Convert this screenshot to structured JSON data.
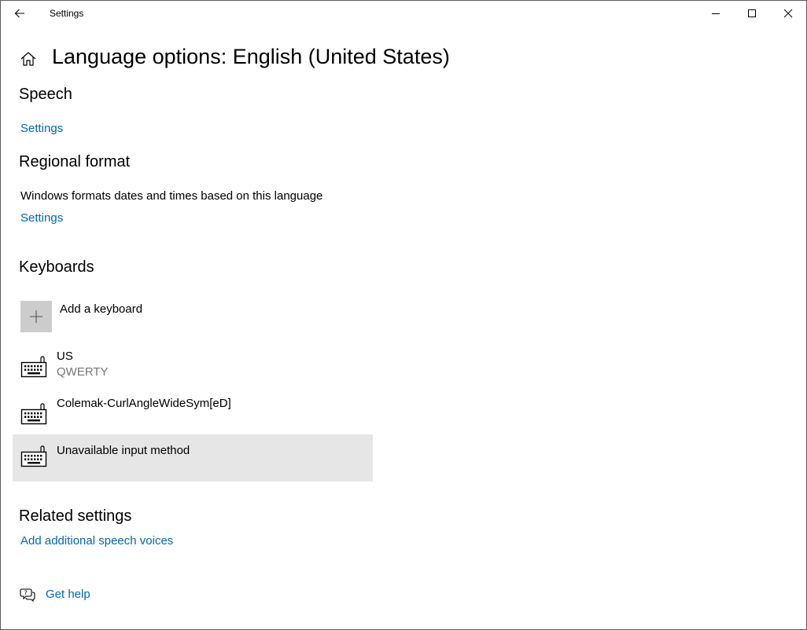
{
  "titlebar": {
    "title": "Settings",
    "back_icon": "back-arrow-icon",
    "minimize_icon": "minimize-icon",
    "maximize_icon": "maximize-icon",
    "close_icon": "close-icon"
  },
  "header": {
    "home_icon": "home-icon",
    "title": "Language options: English (United States)"
  },
  "speech": {
    "heading": "Speech",
    "settings_link": "Settings"
  },
  "regional_format": {
    "heading": "Regional format",
    "description": "Windows formats dates and times based on this language",
    "settings_link": "Settings"
  },
  "keyboards": {
    "heading": "Keyboards",
    "add_label": "Add a keyboard",
    "items": [
      {
        "name": "US",
        "sub": "QWERTY",
        "selected": false
      },
      {
        "name": "Colemak-CurlAngleWideSym[eD]",
        "sub": "",
        "selected": false
      },
      {
        "name": "Unavailable input method",
        "sub": "",
        "selected": true
      }
    ]
  },
  "related_settings": {
    "heading": "Related settings",
    "link": "Add additional speech voices"
  },
  "help": {
    "icon": "get-help-icon",
    "label": "Get help"
  },
  "colors": {
    "accent_link": "#0067b8",
    "selected_bg": "#e6e6e6",
    "add_box_bg": "#cccccc",
    "secondary_text": "#767676"
  }
}
